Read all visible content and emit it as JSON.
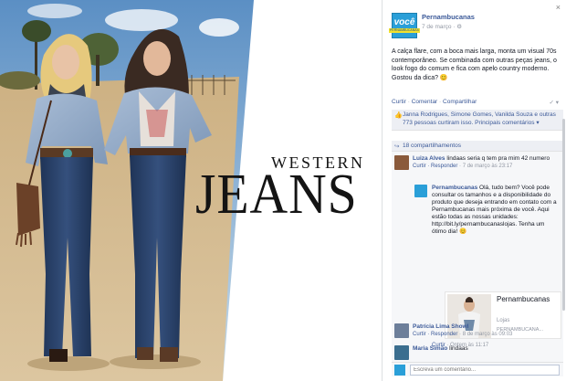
{
  "photo": {
    "headline_small": "WESTERN",
    "headline_big": "JEANS"
  },
  "sidebar": {
    "close_label": "×",
    "page": {
      "logo_text": "você",
      "logo_sub": "PERNAMBUCANAS",
      "name": "Pernambucanas",
      "date": "7 de março · ⚙"
    },
    "post_text": "A calça flare, com a boca mais larga, monta um visual 70s contemporâneo. Se combinada com outras peças jeans, o look fogo do comum e fica com apelo country moderno. Gostou da dica? 😊",
    "actions": [
      "Curtir",
      "Comentar",
      "Compartilhar"
    ],
    "actions_right": "✓ ▾",
    "likes": {
      "icon": "👍",
      "names": "Janna Rodrigues, Simone Gomes, Vanilda Souza e outras 773 pessoas curtiram isso.",
      "top_label": "Principais comentários ▾"
    },
    "shares": {
      "icon": "↪",
      "label": "18 compartilhamentos"
    },
    "comments": [
      {
        "name": "Luiza Alves",
        "text": "lindaas seria q tem pra mim 42 numero",
        "meta_links": "Curtir · Responder",
        "meta_time": "· 7 de março às 23:17",
        "avatar_color": "#8a5a3b"
      },
      {
        "name": "Pernambucanas",
        "text": "Olá, tudo bem? Você pode consultar os tamanhos e a disponibilidade do produto que deseja entrando em contato com a Pernambucanas mais próxima de você. Aqui estão todas as nossas unidades: http://bit.ly/pernambucanaslojas. Tenha um ótimo dia! 😊",
        "meta_links": "Curtir",
        "meta_time": "· Ontem às 11:17",
        "avatar_color": "#2a9fd8"
      },
      {
        "name": "Patrícia Lima Showl",
        "text": "",
        "meta_links": "Curtir · Responder",
        "meta_time": "· 8 de março às 09:03",
        "avatar_color": "#6d7f9a"
      },
      {
        "name": "Maria Simão",
        "text": "lindaas",
        "meta_links": "",
        "meta_time": "",
        "avatar_color": "#3b6e8f"
      }
    ],
    "link_card": {
      "title": "Pernambucanas",
      "subtitle": "Lojas",
      "url": "PERNAMBUCANA..."
    },
    "comment_placeholder": "Escreva um comentário..."
  }
}
